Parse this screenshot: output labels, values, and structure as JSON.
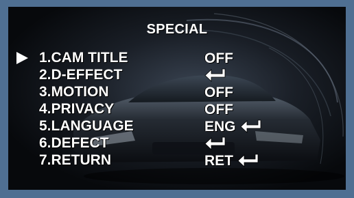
{
  "osd": {
    "title": "SPECIAL",
    "items": [
      {
        "label": "1.CAM TITLE",
        "value": "OFF",
        "enter": false,
        "selected": true
      },
      {
        "label": "2.D-EFFECT",
        "value": "",
        "enter": true,
        "selected": false
      },
      {
        "label": "3.MOTION",
        "value": "OFF",
        "enter": false,
        "selected": false
      },
      {
        "label": "4.PRIVACY",
        "value": "OFF",
        "enter": false,
        "selected": false
      },
      {
        "label": "5.LANGUAGE",
        "value": "ENG",
        "enter": true,
        "selected": false
      },
      {
        "label": "6.DEFECT",
        "value": "",
        "enter": true,
        "selected": false
      },
      {
        "label": "7.RETURN",
        "value": "RET",
        "enter": true,
        "selected": false
      }
    ]
  },
  "colors": {
    "frame": "#4f6f92",
    "screen": "#0a0c10",
    "text": "#ffffff"
  },
  "icons": {
    "cursor": "triangle-right",
    "enter": "return-arrow"
  }
}
